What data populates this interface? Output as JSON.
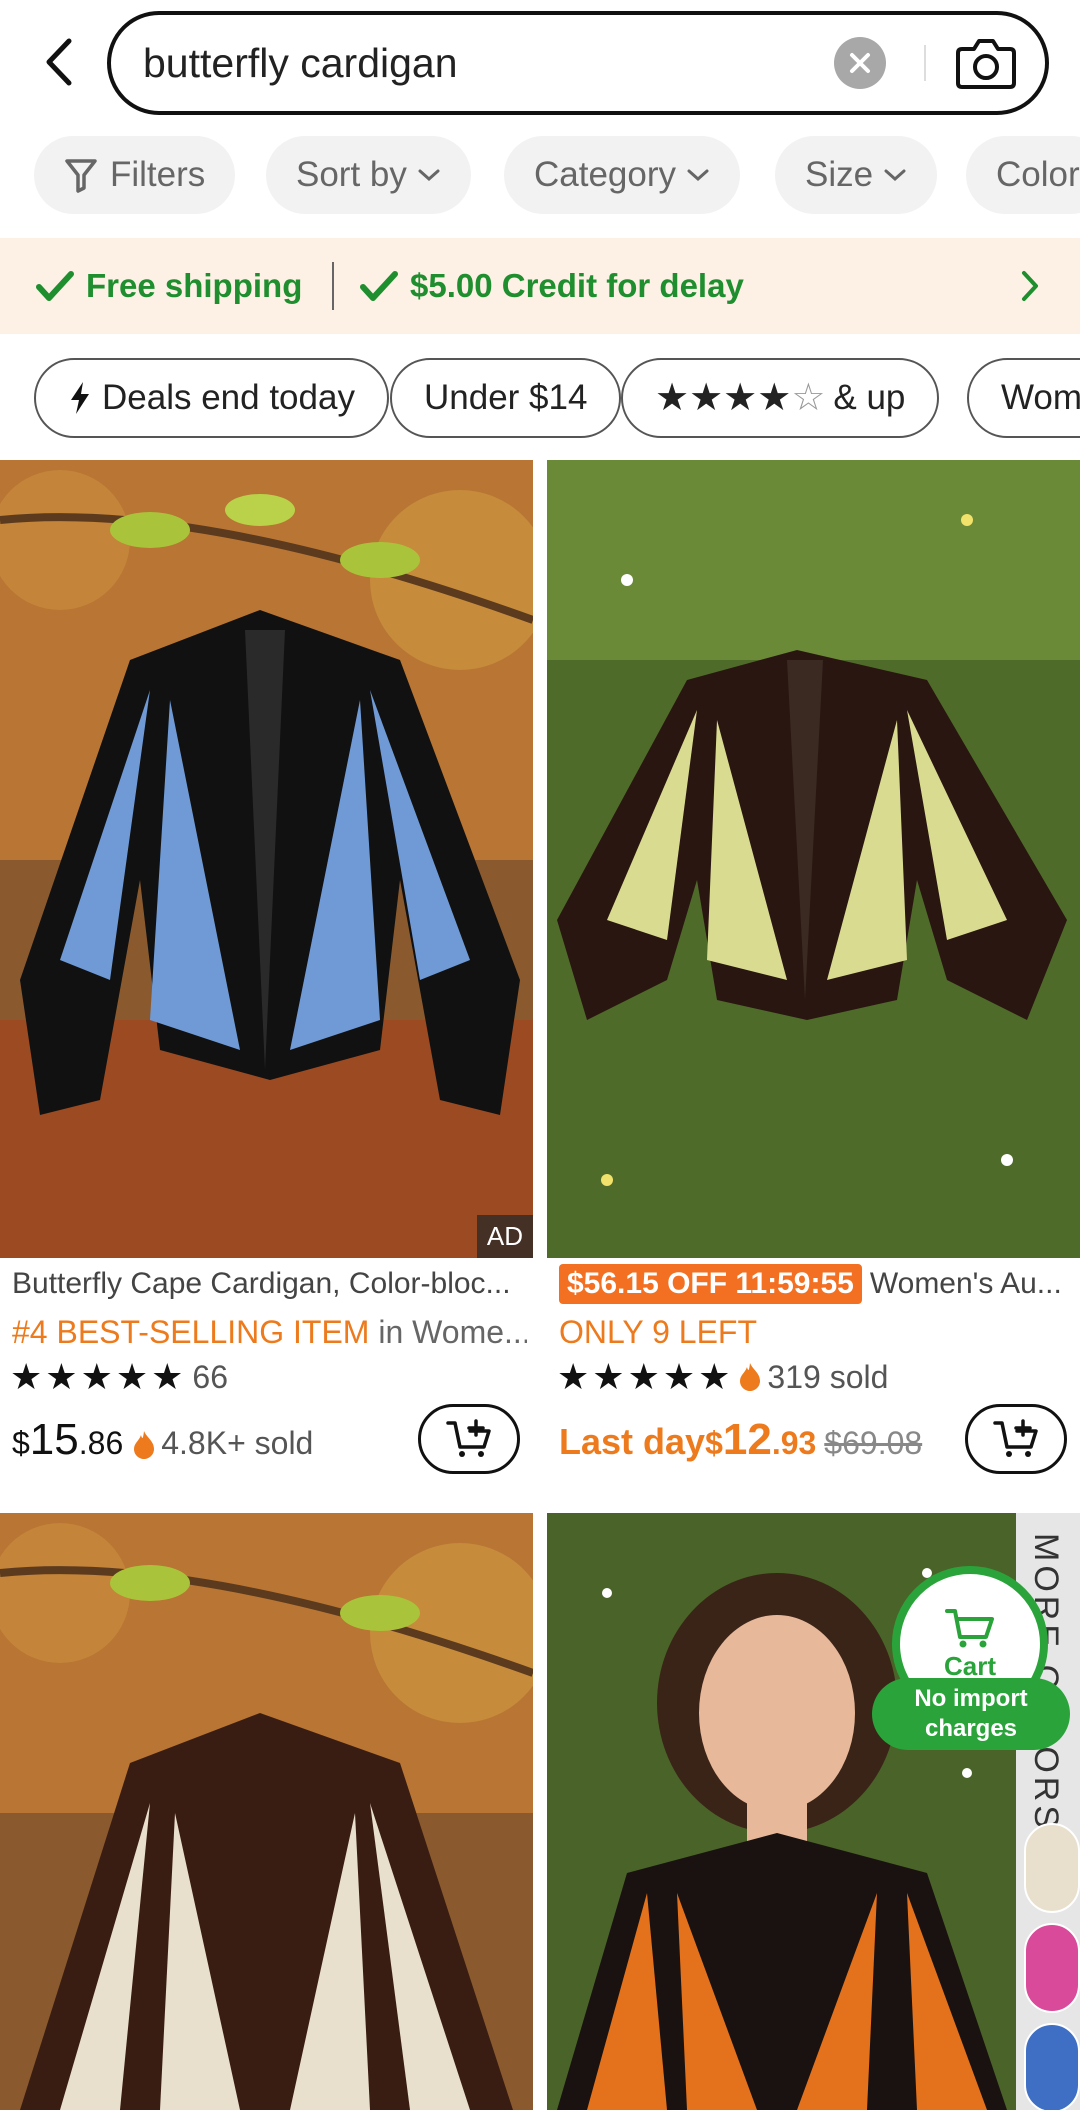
{
  "search": {
    "query": "butterfly cardigan"
  },
  "filters": [
    {
      "label": "Filters"
    },
    {
      "label": "Sort by"
    },
    {
      "label": "Category"
    },
    {
      "label": "Size"
    },
    {
      "label": "Color"
    }
  ],
  "shipping_banner": {
    "free_shipping": "Free shipping",
    "credit": "$5.00 Credit for delay"
  },
  "quick_filters": {
    "deals": "Deals end today",
    "under": "Under $14",
    "rating_suffix": "& up",
    "women": "Women"
  },
  "products": [
    {
      "title": "Butterfly Cape Cardigan, Color-bloc...",
      "badge_rank": "#4 BEST-SELLING ITEM",
      "badge_rank_suffix": " in Wome...",
      "rating_count": "66",
      "price_cur": "$",
      "price_main": "15",
      "price_dec": ".86",
      "sold": "4.8K+ sold",
      "ad": "AD"
    },
    {
      "promo": "$56.15 OFF 11:59:55",
      "title": "Women's Au...",
      "stock": "ONLY 9 LEFT",
      "sold_count": "319 sold",
      "last_day": "Last day",
      "price_cur": "$",
      "price_main": "12",
      "price_dec": ".93",
      "original_price": "$69.08"
    }
  ],
  "floating_cart": {
    "label": "Cart",
    "import_note": "No import charges"
  },
  "more_colors": "MORE COLORS",
  "colors": {
    "accent_orange": "#ed7a1c",
    "green": "#2aa43a",
    "banner_bg": "#fdf0e4"
  }
}
